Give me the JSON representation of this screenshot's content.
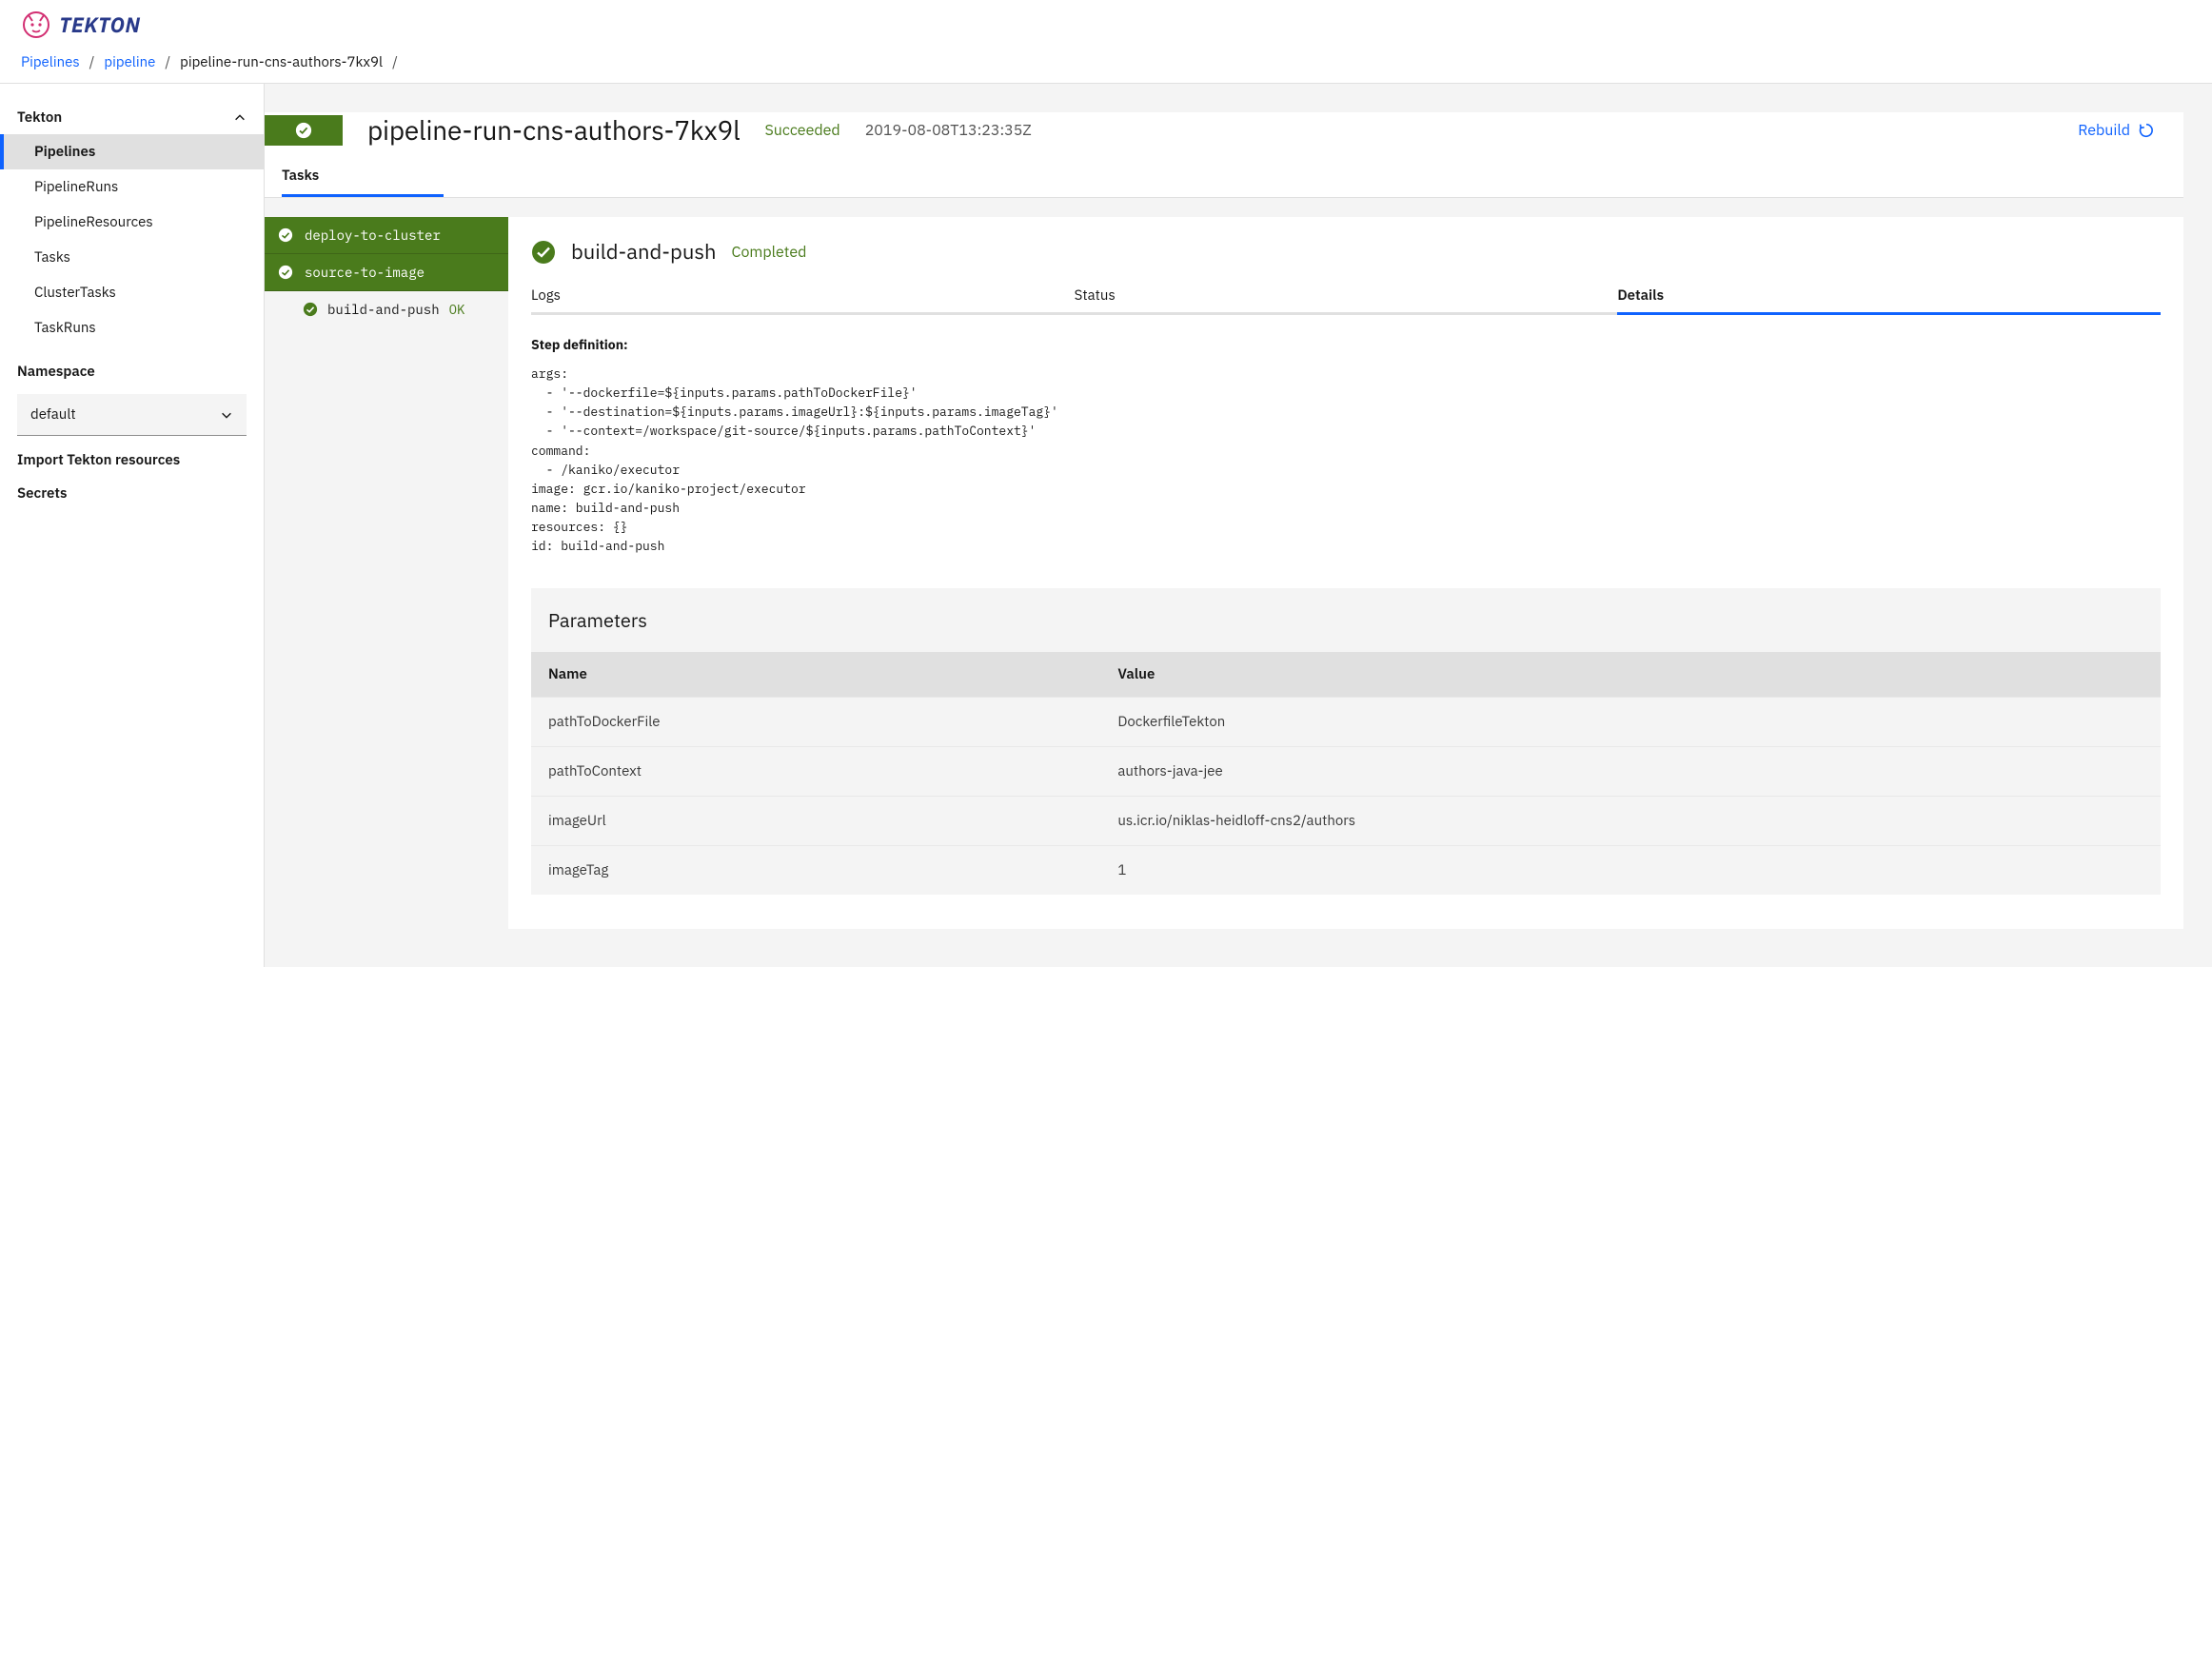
{
  "logo": {
    "text": "TEKTON"
  },
  "breadcrumb": {
    "items": [
      "Pipelines",
      "pipeline",
      "pipeline-run-cns-authors-7kx9l"
    ]
  },
  "sidebar": {
    "group_label": "Tekton",
    "items": [
      {
        "label": "Pipelines",
        "active": true
      },
      {
        "label": "PipelineRuns"
      },
      {
        "label": "PipelineResources"
      },
      {
        "label": "Tasks"
      },
      {
        "label": "ClusterTasks"
      },
      {
        "label": "TaskRuns"
      }
    ],
    "namespace_label": "Namespace",
    "namespace_value": "default",
    "import_label": "Import Tekton resources",
    "secrets_label": "Secrets"
  },
  "run": {
    "title": "pipeline-run-cns-authors-7kx9l",
    "status": "Succeeded",
    "timestamp": "2019-08-08T13:23:35Z",
    "rebuild_label": "Rebuild",
    "tab_label": "Tasks"
  },
  "tasks": [
    {
      "name": "deploy-to-cluster",
      "kind": "group"
    },
    {
      "name": "source-to-image",
      "kind": "group"
    },
    {
      "name": "build-and-push",
      "kind": "step",
      "status": "OK",
      "selected": true
    }
  ],
  "step": {
    "name": "build-and-push",
    "status": "Completed",
    "sub_tabs": [
      "Logs",
      "Status",
      "Details"
    ],
    "active_sub_tab": "Details",
    "definition_label": "Step definition:",
    "yaml": "args:\n  - '--dockerfile=${inputs.params.pathToDockerFile}'\n  - '--destination=${inputs.params.imageUrl}:${inputs.params.imageTag}'\n  - '--context=/workspace/git-source/${inputs.params.pathToContext}'\ncommand:\n  - /kaniko/executor\nimage: gcr.io/kaniko-project/executor\nname: build-and-push\nresources: {}\nid: build-and-push",
    "params_title": "Parameters",
    "params_headers": {
      "name": "Name",
      "value": "Value"
    },
    "params": [
      {
        "name": "pathToDockerFile",
        "value": "DockerfileTekton"
      },
      {
        "name": "pathToContext",
        "value": "authors-java-jee"
      },
      {
        "name": "imageUrl",
        "value": "us.icr.io/niklas-heidloff-cns2/authors"
      },
      {
        "name": "imageTag",
        "value": "1"
      }
    ]
  }
}
